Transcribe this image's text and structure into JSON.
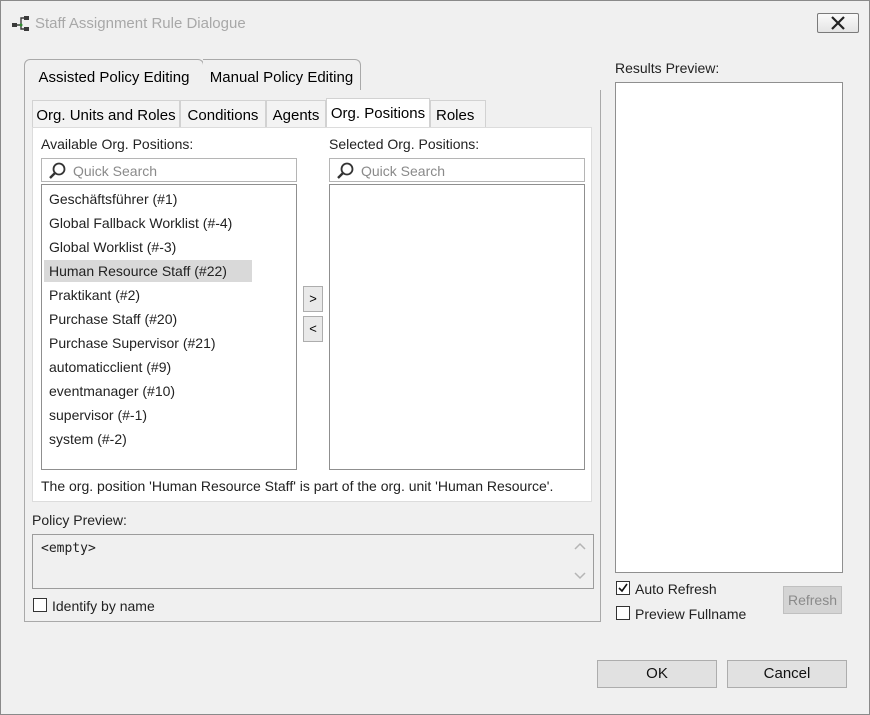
{
  "window": {
    "title": "Staff Assignment Rule Dialogue"
  },
  "outer_tabs": [
    {
      "label": "Assisted Policy Editing",
      "active": true
    },
    {
      "label": "Manual Policy Editing",
      "active": false
    }
  ],
  "inner_tabs": [
    {
      "label": "Org. Units and Roles",
      "active": false
    },
    {
      "label": "Conditions",
      "active": false
    },
    {
      "label": "Agents",
      "active": false
    },
    {
      "label": "Org. Positions",
      "active": true
    },
    {
      "label": "Roles",
      "active": false
    }
  ],
  "available": {
    "label": "Available Org. Positions:",
    "search_placeholder": "Quick Search",
    "items": [
      "Geschäftsführer (#1)",
      "Global Fallback Worklist (#-4)",
      "Global Worklist (#-3)",
      "Human Resource Staff (#22)",
      "Praktikant (#2)",
      "Purchase Staff (#20)",
      "Purchase Supervisor (#21)",
      "automaticclient (#9)",
      "eventmanager (#10)",
      "supervisor (#-1)",
      "system (#-2)"
    ],
    "selected_item": "Human Resource Staff (#22)"
  },
  "selected": {
    "label": "Selected Org. Positions:",
    "search_placeholder": "Quick Search",
    "items": []
  },
  "move_buttons": {
    "add": ">",
    "remove": "<"
  },
  "info_text": "The org. position 'Human Resource Staff' is part of the org. unit 'Human Resource'.",
  "policy_preview": {
    "label": "Policy Preview:",
    "value": "<empty>"
  },
  "identify_by_name": {
    "label": "Identify by name",
    "checked": false
  },
  "results_preview": {
    "label": "Results Preview:"
  },
  "auto_refresh": {
    "label": "Auto Refresh",
    "checked": true
  },
  "preview_fullname": {
    "label": "Preview Fullname",
    "checked": false
  },
  "refresh_button": "Refresh",
  "ok_button": "OK",
  "cancel_button": "Cancel",
  "icons": {
    "app": "staff-assignment-icon",
    "close": "close-icon",
    "search": "search-icon",
    "scroll_up": "scroll-up-icon",
    "scroll_down": "scroll-down-icon",
    "check": "checkmark-icon"
  }
}
